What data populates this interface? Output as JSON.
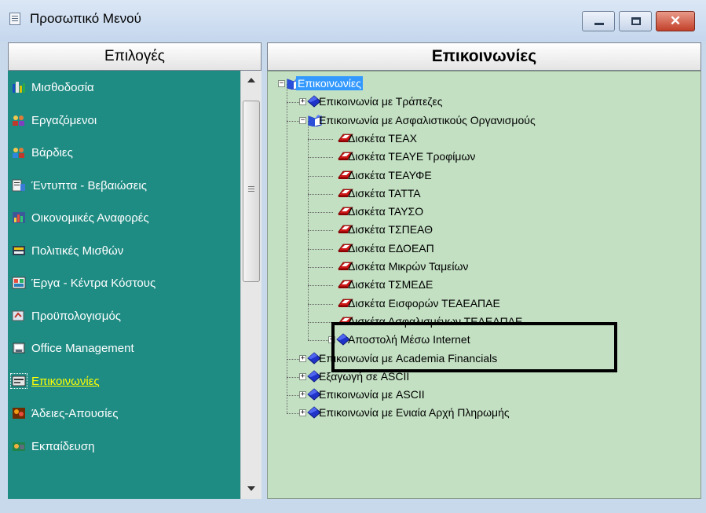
{
  "window": {
    "title": "Προσωπικό Μενού"
  },
  "left_panel": {
    "header": "Επιλογές",
    "items": [
      {
        "label": "Μισθοδοσία",
        "icon": "payroll-icon",
        "active": false
      },
      {
        "label": "Εργαζόμενοι",
        "icon": "employees-icon",
        "active": false
      },
      {
        "label": "Βάρδιες",
        "icon": "shifts-icon",
        "active": false
      },
      {
        "label": "Έντυπτα - Βεβαιώσεις",
        "icon": "forms-icon",
        "active": false
      },
      {
        "label": "Οικονομικές Αναφορές",
        "icon": "financial-reports-icon",
        "active": false
      },
      {
        "label": "Πολιτικές Μισθών",
        "icon": "salary-policies-icon",
        "active": false
      },
      {
        "label": "Έργα - Κέντρα Κόστους",
        "icon": "projects-icon",
        "active": false
      },
      {
        "label": "Προϋπολογισμός",
        "icon": "budget-icon",
        "active": false
      },
      {
        "label": "Office Management",
        "icon": "office-icon",
        "active": false
      },
      {
        "label": "Επικοινωνίες",
        "icon": "communications-icon",
        "active": true
      },
      {
        "label": "Άδειες-Απουσίες",
        "icon": "leave-icon",
        "active": false
      },
      {
        "label": "Εκπαίδευση",
        "icon": "training-icon",
        "active": false
      }
    ]
  },
  "right_panel": {
    "header": "Επικοινωνίες",
    "tree": [
      {
        "label": "Επικοινωνίες",
        "depth": 0,
        "expander": "minus",
        "icon": "open-book-icon",
        "selected": true
      },
      {
        "label": "Επικοινωνία με Τράπεζες",
        "depth": 1,
        "expander": "plus",
        "icon": "closed-book-icon"
      },
      {
        "label": "Επικοινωνία με Ασφαλιστικούς Οργανισμούς",
        "depth": 1,
        "expander": "minus",
        "icon": "open-book-icon"
      },
      {
        "label": "Δισκέτα ΤΕΑΧ",
        "depth": 2,
        "icon": "diskette-icon"
      },
      {
        "label": "Δισκέτα ΤΕΑΥΕ Τροφίμων",
        "depth": 2,
        "icon": "diskette-icon"
      },
      {
        "label": "Δισκέτα ΤΕΑΥΦΕ",
        "depth": 2,
        "icon": "diskette-icon"
      },
      {
        "label": "Δισκέτα ΤΑΤΤΑ",
        "depth": 2,
        "icon": "diskette-icon"
      },
      {
        "label": "Δισκέτα ΤΑΥΣΟ",
        "depth": 2,
        "icon": "diskette-icon"
      },
      {
        "label": "Δισκέτα ΤΣΠΕΑΘ",
        "depth": 2,
        "icon": "diskette-icon"
      },
      {
        "label": "Δισκέτα ΕΔΟΕΑΠ",
        "depth": 2,
        "icon": "diskette-icon"
      },
      {
        "label": "Δισκέτα Μικρών Ταμείων",
        "depth": 2,
        "icon": "diskette-icon"
      },
      {
        "label": "Δισκέτα ΤΣΜΕΔΕ",
        "depth": 2,
        "icon": "diskette-icon"
      },
      {
        "label": "Δισκέτα Εισφορών ΤΕΑΕΑΠΑΕ",
        "depth": 2,
        "icon": "diskette-icon"
      },
      {
        "label": "Δισκέτα Ασφαλισμένων ΤΕΑΕΑΠΑΕ",
        "depth": 2,
        "icon": "diskette-icon"
      },
      {
        "label": "Αποστολή Μέσω Internet",
        "depth": 2,
        "expander": "plus",
        "icon": "closed-book-icon"
      },
      {
        "label": "Επικοινωνία με Academia Financials",
        "depth": 1,
        "expander": "plus",
        "icon": "closed-book-icon"
      },
      {
        "label": "Εξαγωγή σε ASCII",
        "depth": 1,
        "expander": "plus",
        "icon": "closed-book-icon"
      },
      {
        "label": "Επικοινωνία με ASCII",
        "depth": 1,
        "expander": "plus",
        "icon": "closed-book-icon"
      },
      {
        "label": "Επικοινωνία με Ενιαία Αρχή Πληρωμής",
        "depth": 1,
        "expander": "plus",
        "icon": "closed-book-icon"
      }
    ]
  },
  "colors": {
    "left_panel_bg": "#1f8c84",
    "tree_panel_bg": "#c3e0c3",
    "active_item_text": "#ffff00",
    "selection_bg": "#3399ff"
  }
}
